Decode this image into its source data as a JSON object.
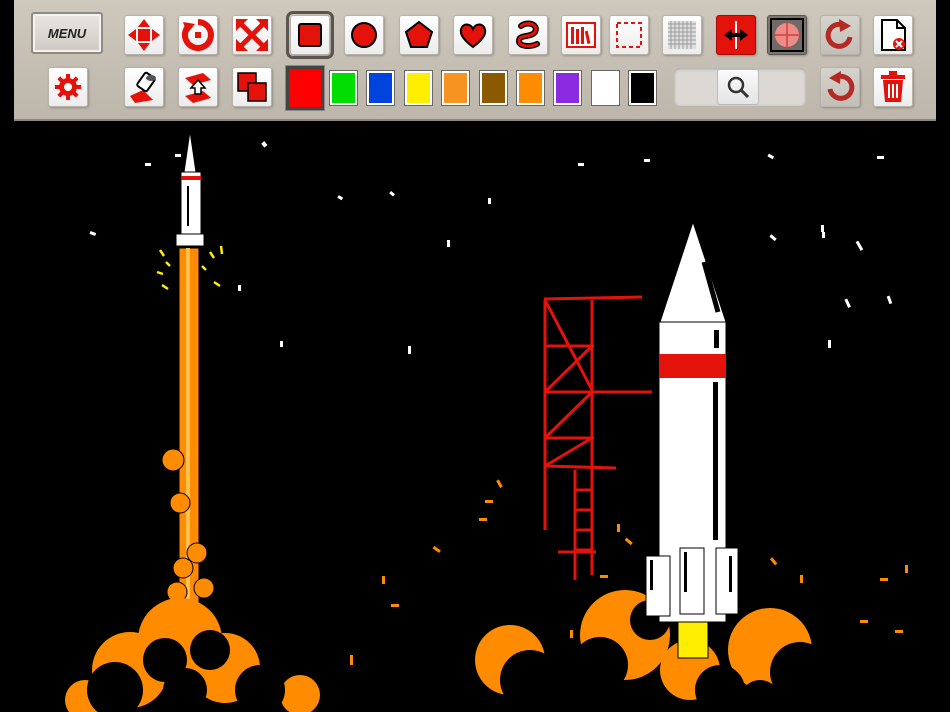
{
  "toolbar": {
    "menu_label": "MENU"
  },
  "palette": {
    "selected_color": "#ff0000",
    "colors": [
      "#ff0000",
      "#00dd00",
      "#0044dd",
      "#ffee00",
      "#f79421",
      "#8b5a00",
      "#ff8c00",
      "#8a2be2",
      "#ffffff",
      "#000000"
    ]
  },
  "icons": {
    "row1": [
      "move-icon",
      "rotate-icon",
      "resize-icon",
      "square-shape-icon",
      "circle-shape-icon",
      "pentagon-shape-icon",
      "heart-shape-icon",
      "curve-shape-icon",
      "stamp-library-icon",
      "selection-icon",
      "grid-icon",
      "flip-icon",
      "target-icon",
      "redo-icon",
      "new-page-icon"
    ],
    "row2": [
      "settings-icon",
      "fill-bucket-icon",
      "layer-order-icon",
      "duplicate-icon",
      "search-icon",
      "undo-icon",
      "delete-icon"
    ]
  },
  "accent_color": "#e3120b"
}
